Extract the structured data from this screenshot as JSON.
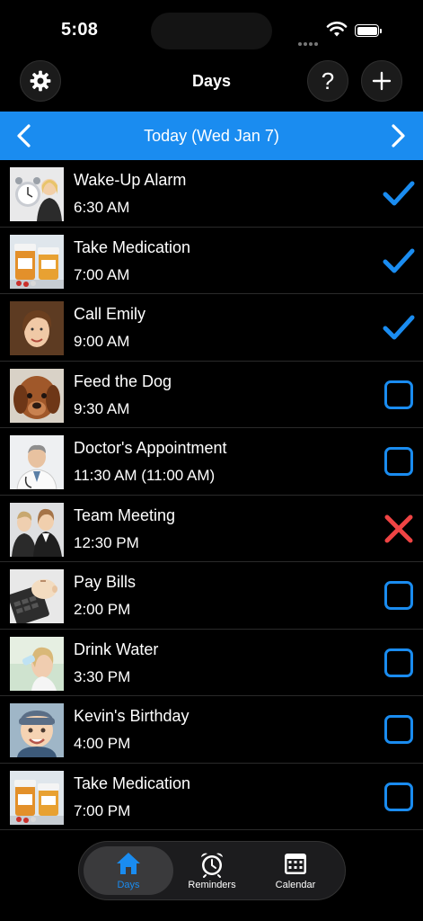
{
  "status_bar": {
    "time": "5:08"
  },
  "nav": {
    "title": "Days",
    "help_label": "?",
    "settings_icon": "gear-icon",
    "add_icon": "plus-icon"
  },
  "date_header": {
    "label": "Today (Wed Jan 7)"
  },
  "reminders": [
    {
      "title": "Wake-Up Alarm",
      "time": "6:30 AM",
      "state": "done",
      "thumb": "alarm-clock-woman"
    },
    {
      "title": "Take Medication",
      "time": "7:00 AM",
      "state": "done",
      "thumb": "pill-bottles"
    },
    {
      "title": "Call Emily",
      "time": "9:00 AM",
      "state": "done",
      "thumb": "smiling-woman"
    },
    {
      "title": "Feed the Dog",
      "time": "9:30 AM",
      "state": "pending",
      "thumb": "dog"
    },
    {
      "title": "Doctor's Appointment",
      "time": "11:30 AM (11:00 AM)",
      "state": "pending",
      "thumb": "doctor"
    },
    {
      "title": "Team Meeting",
      "time": "12:30 PM",
      "state": "missed",
      "thumb": "business-people"
    },
    {
      "title": "Pay Bills",
      "time": "2:00 PM",
      "state": "pending",
      "thumb": "piggy-bank-calculator"
    },
    {
      "title": "Drink Water",
      "time": "3:30 PM",
      "state": "pending",
      "thumb": "woman-drinking"
    },
    {
      "title": "Kevin's Birthday",
      "time": "4:00 PM",
      "state": "pending",
      "thumb": "baby-boy"
    },
    {
      "title": "Take Medication",
      "time": "7:00 PM",
      "state": "pending",
      "thumb": "pill-bottles"
    }
  ],
  "tabs": [
    {
      "label": "Days",
      "active": true,
      "icon": "house-icon"
    },
    {
      "label": "Reminders",
      "active": false,
      "icon": "alarm-clock-icon"
    },
    {
      "label": "Calendar",
      "active": false,
      "icon": "calendar-icon"
    }
  ],
  "colors": {
    "accent": "#1a8cf0",
    "missed": "#ef4444",
    "background": "#000000",
    "tab_active": "#1a8cf0"
  }
}
